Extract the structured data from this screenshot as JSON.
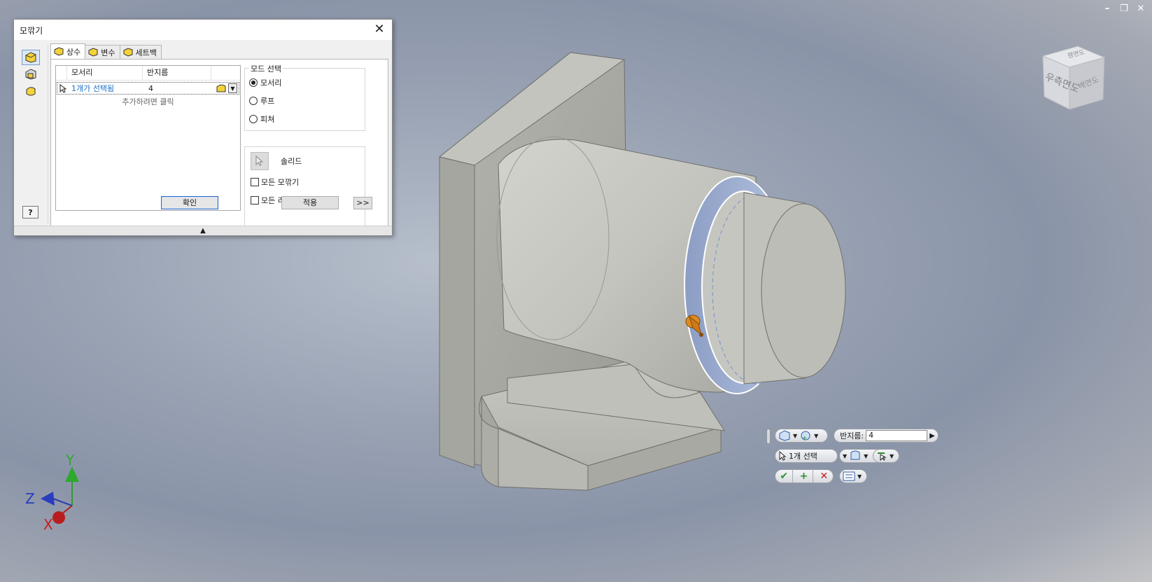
{
  "window_controls": {
    "minimize": "–",
    "restore": "❐",
    "close": "✕"
  },
  "dialog": {
    "title": "모깎기",
    "close_label": "✕",
    "help_label": "?",
    "tabs": [
      {
        "label": "상수"
      },
      {
        "label": "변수"
      },
      {
        "label": "세트백"
      }
    ],
    "grid": {
      "headers": [
        "모서리",
        "반지름"
      ],
      "rows": [
        {
          "edges": "1개가 선택됨",
          "radius": "4"
        }
      ],
      "add_hint": "추가하려면 클릭"
    },
    "mode_group": {
      "title": "모드 선택",
      "options": [
        "모서리",
        "루프",
        "피쳐"
      ],
      "selected": "모서리"
    },
    "solid_label": "솔리드",
    "checkboxes": [
      "모든 모깎기",
      "모든 라"
    ],
    "ok_label": "확인",
    "apply_label": "적용",
    "more_label": ">>",
    "collapse_glyph": "▲"
  },
  "viewcube": {
    "front_label": "우측면도",
    "side_label": "배면도",
    "top_label": "평면도"
  },
  "mini_toolbar": {
    "radius_label": "반지름:",
    "radius_value": "4",
    "selection_label": "1개 선택",
    "ok_glyph": "✔",
    "add_glyph": "+",
    "cancel_glyph": "✕"
  },
  "triad": {
    "x": "X",
    "y": "Y",
    "z": "Z"
  },
  "colors": {
    "accent_blue": "#1a6fc4",
    "ok_green": "#2f8f2f",
    "cancel_red": "#c81e1e",
    "manipulator_orange": "#e08a1e"
  }
}
